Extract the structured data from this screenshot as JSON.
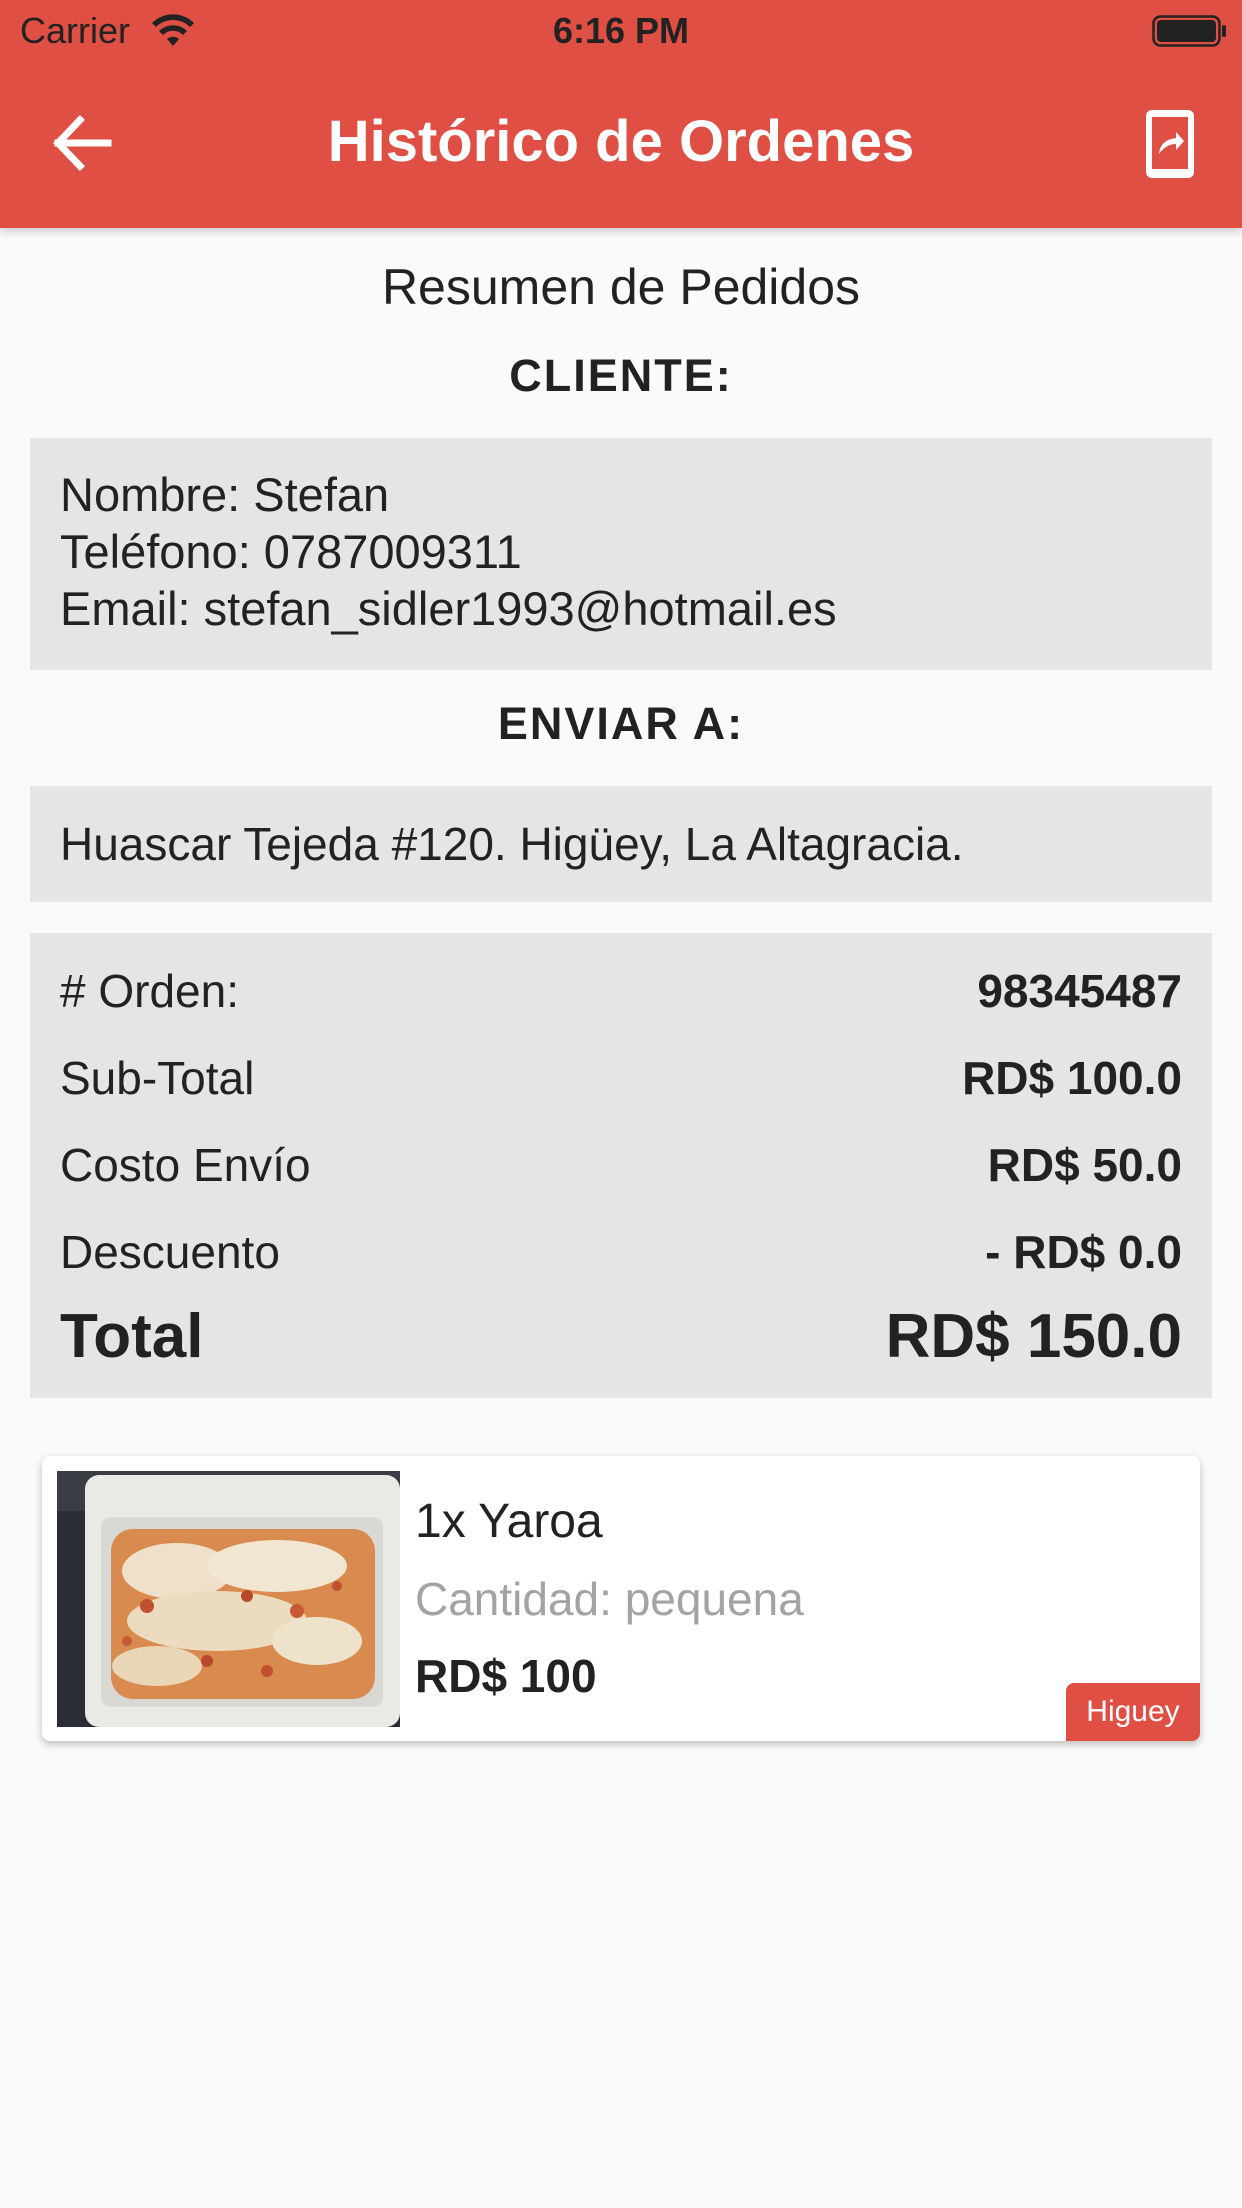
{
  "status_bar": {
    "carrier": "Carrier",
    "time": "6:16 PM"
  },
  "header": {
    "title": "Histórico de Ordenes",
    "back_icon": "arrow-left-icon",
    "share_icon": "share-icon",
    "color": "#e04f44"
  },
  "summary": {
    "title": "Resumen de Pedidos",
    "client_label": "CLIENTE:",
    "client": {
      "name_line": "Nombre: Stefan",
      "phone_line": "Teléfono: 0787009311",
      "email_line": "Email: stefan_sidler1993@hotmail.es"
    },
    "ship_label": "ENVIAR A:",
    "ship_address": "Huascar Tejeda #120. Higüey, La Altagracia."
  },
  "order": {
    "rows": [
      {
        "label": "# Orden:",
        "value": "98345487"
      },
      {
        "label": "Sub-Total",
        "value": "RD$  100.0"
      },
      {
        "label": "Costo Envío",
        "value": "RD$  50.0"
      },
      {
        "label": "Descuento",
        "value": "- RD$  0.0"
      }
    ],
    "total": {
      "label": "Total",
      "value": "RD$  150.0"
    }
  },
  "item": {
    "name": "1x Yaroa",
    "quantity": "Cantidad: pequena",
    "price": "RD$  100",
    "badge": "Higuey"
  }
}
